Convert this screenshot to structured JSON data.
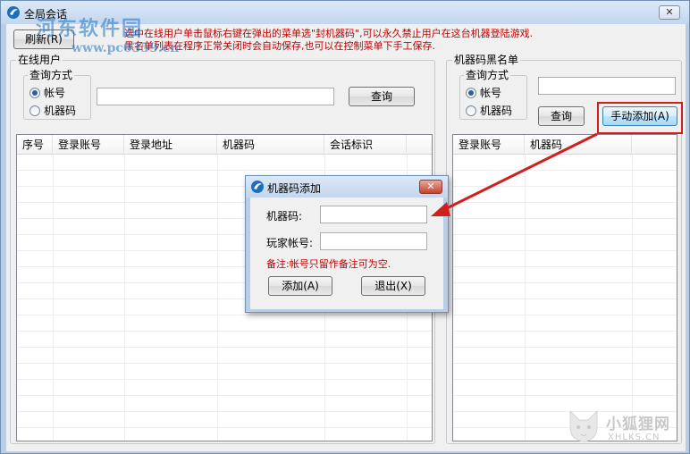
{
  "window": {
    "title": "全局会话",
    "close_label": "✕"
  },
  "watermark": {
    "logo_text": "河东软件园",
    "url_text": "www.pc0359.cn"
  },
  "toolbar": {
    "refresh_label": "刷新(R)"
  },
  "hint": {
    "line1": "选中在线用户单击鼠标右键在弹出的菜单选\"封机器码\",可以永久禁止用户在这台机器登陆游戏.",
    "line2": "黑名单列表在程序正常关闭时会自动保存,也可以在控制菜单下手工保存."
  },
  "online": {
    "group_title": "在线用户",
    "query_group_title": "查询方式",
    "radio_account": "帐号",
    "radio_machine": "机器码",
    "search_value": "",
    "query_button": "查询",
    "columns": [
      "序号",
      "登录账号",
      "登录地址",
      "机器码",
      "会话标识"
    ]
  },
  "blacklist": {
    "group_title": "机器码黑名单",
    "query_group_title": "查询方式",
    "radio_account": "帐号",
    "radio_machine": "机器码",
    "search_value": "",
    "query_button": "查询",
    "manual_add_button": "手动添加(A)",
    "columns": [
      "登录账号",
      "机器码"
    ]
  },
  "dialog": {
    "title": "机器码添加",
    "close_label": "✕",
    "machine_label": "机器码:",
    "machine_value": "",
    "account_label": "玩家帐号:",
    "account_value": "",
    "note": "备注:帐号只留作备注可为空.",
    "add_button": "添加(A)",
    "exit_button": "退出(X)"
  },
  "site_watermark": {
    "name": "小狐狸网",
    "domain": "XHLKS.CN"
  },
  "colors": {
    "highlight_red": "#d0201e",
    "hint_red": "#c00000",
    "accent_blue": "#2a5fa8"
  }
}
